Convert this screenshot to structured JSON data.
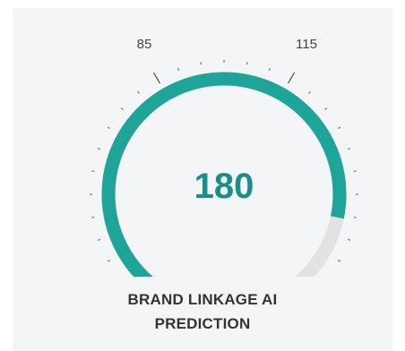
{
  "gauge": {
    "value": 180,
    "value_label": "180",
    "fill_fraction": 0.85,
    "tick_label_left": "85",
    "tick_label_right": "115",
    "arc_color": "#1fa49a",
    "track_color": "#e2e2e2",
    "value_color": "#1a8f88"
  },
  "title": {
    "line1": "BRAND LINKAGE AI",
    "line2": "PREDICTION"
  }
}
